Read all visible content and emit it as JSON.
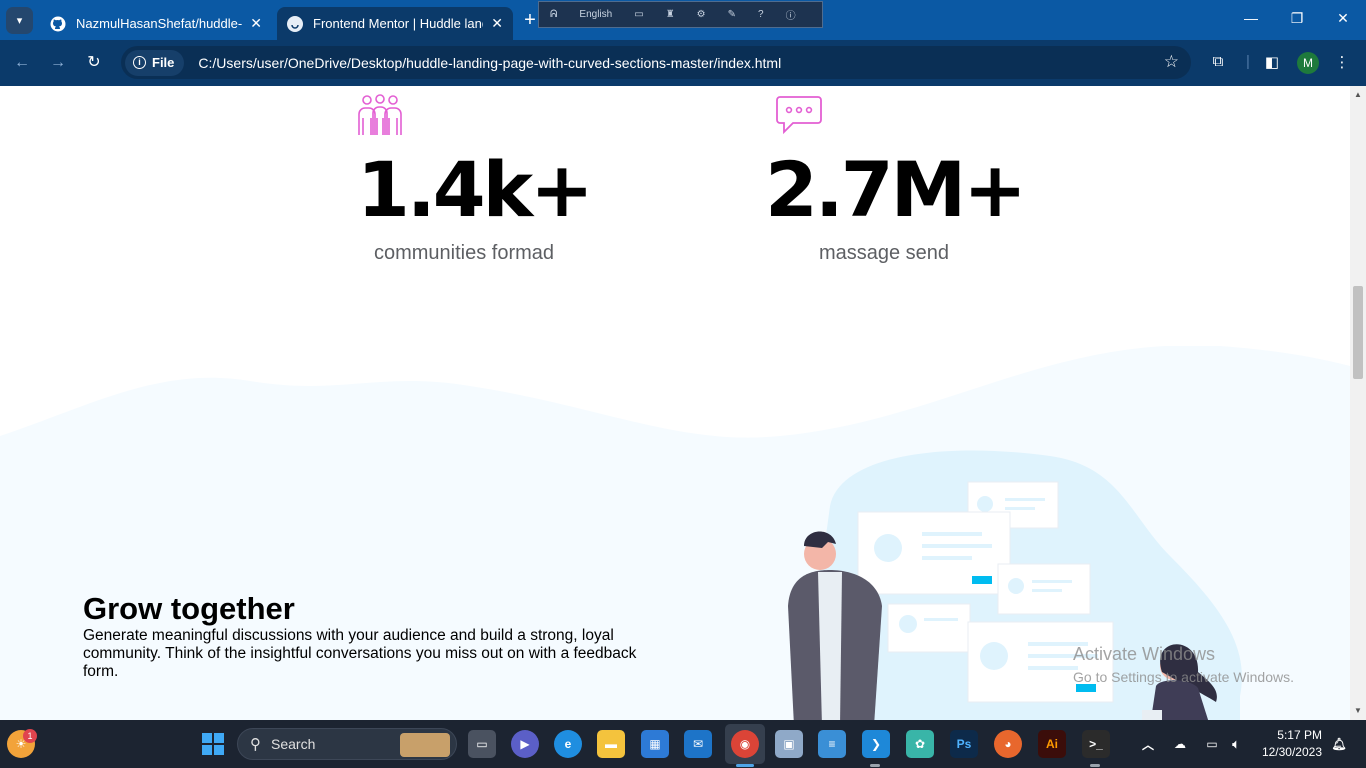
{
  "browser": {
    "tabs": [
      {
        "title": "NazmulHasanShefat/huddle-landing",
        "active": false
      },
      {
        "title": "Frontend Mentor | Huddle landing",
        "active": true
      }
    ],
    "language_bar": {
      "label": "English"
    },
    "address": {
      "scheme_label": "File",
      "url": "C:/Users/user/OneDrive/Desktop/huddle-landing-page-with-curved-sections-master/index.html"
    },
    "profile_initial": "M"
  },
  "page": {
    "stats": [
      {
        "icon": "communities-icon",
        "value": "1.4k+",
        "label": "communities formad"
      },
      {
        "icon": "messages-icon",
        "value": "2.7M+",
        "label": "massage send"
      }
    ],
    "section": {
      "title": "Grow together",
      "text": "Generate meaningful discussions with your audience and build a strong, loyal community. Think of the insightful conversations you miss out on with a feedback form."
    },
    "watermark": {
      "line1": "Activate Windows",
      "line2": "Go to Settings to activate Windows."
    },
    "colors": {
      "accent": "#e35fd3",
      "section_bg": "#f5fbff",
      "illustration_blob": "#dff3fd",
      "chrome": "#0b3a6a"
    }
  },
  "taskbar": {
    "search_placeholder": "Search",
    "notification_count": "1",
    "time": "5:17 PM",
    "date": "12/30/2023"
  }
}
